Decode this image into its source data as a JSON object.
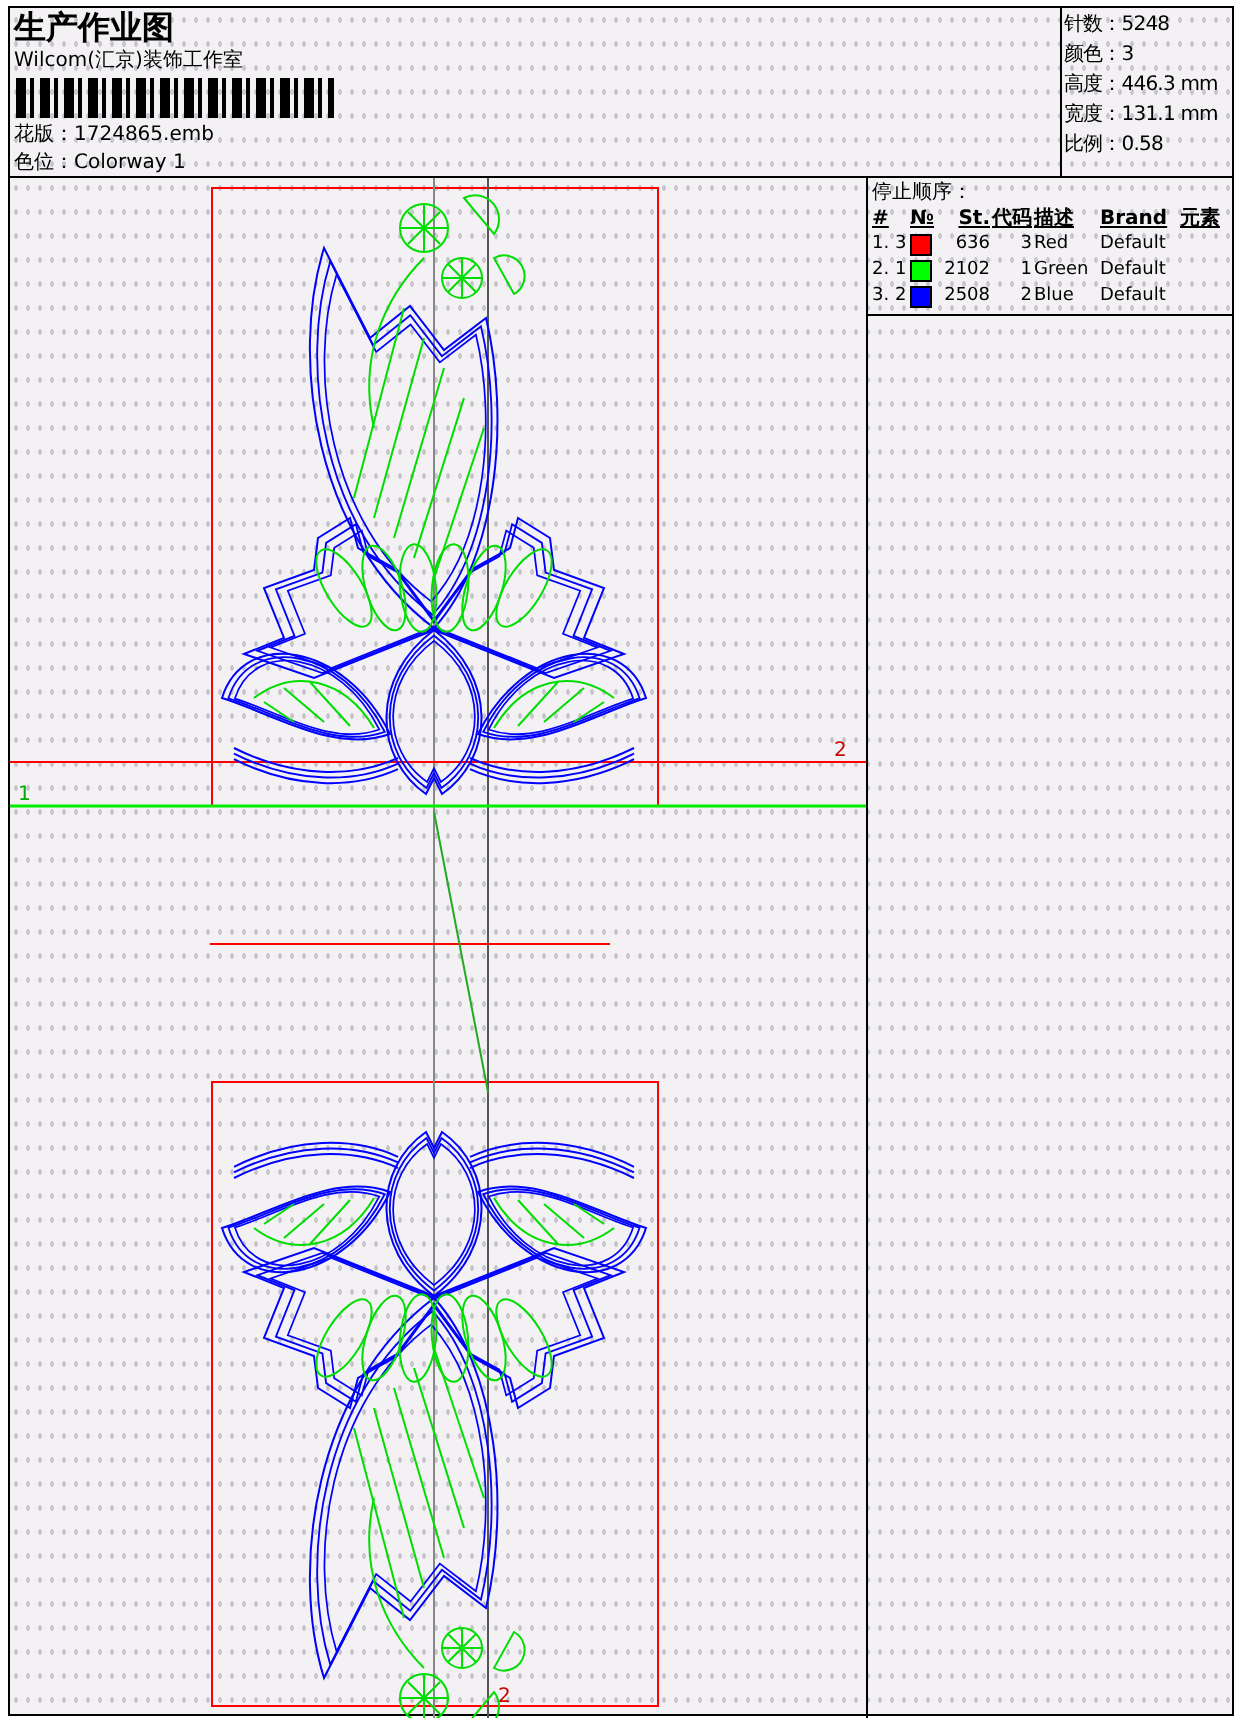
{
  "header": {
    "title": "生产作业图",
    "company": "Wilcom(汇京)装饰工作室",
    "design_file": "花版：1724865.emb",
    "colorway": "色位：Colorway 1"
  },
  "stats": [
    "针数：5248",
    "颜色：3",
    "高度：446.3 mm",
    "宽度：131.1 mm",
    "比例：0.58"
  ],
  "stop_sequence": {
    "title": "停止顺序：",
    "columns": [
      "#",
      "№",
      "St.",
      "代码",
      "描述",
      "Brand",
      "元素"
    ],
    "rows": [
      {
        "index": "1. 3",
        "color": "#ff0000",
        "stitches": "636",
        "code": "3",
        "description": "Red",
        "brand": "Default"
      },
      {
        "index": "2. 1",
        "color": "#00ff00",
        "stitches": "2102",
        "code": "1",
        "description": "Green",
        "brand": "Default"
      },
      {
        "index": "3. 2",
        "color": "#0000ff",
        "stitches": "2508",
        "code": "2",
        "description": "Blue",
        "brand": "Default"
      }
    ]
  },
  "canvas": {
    "markers": [
      "2",
      "1",
      "2"
    ]
  }
}
